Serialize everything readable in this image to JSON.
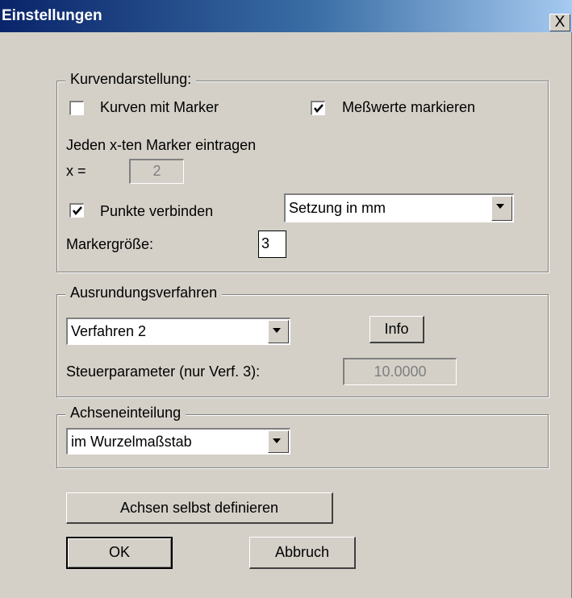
{
  "window": {
    "title": "Einstellungen",
    "close_glyph": "X"
  },
  "kurven": {
    "legend": "Kurvendarstellung:",
    "marker_cb": {
      "label": "Kurven mit Marker",
      "checked": false
    },
    "messwerte_cb": {
      "label": "Meßwerte markieren",
      "checked": true
    },
    "every_nth_label": "Jeden x-ten Marker eintragen",
    "x_label": "x =",
    "x_value": "2",
    "punkte_cb": {
      "label": "Punkte verbinden",
      "checked": true
    },
    "setzung_select": "Setzung in mm",
    "markersize_label": "Markergröße:",
    "markersize_value": "3"
  },
  "ausrundung": {
    "legend": "Ausrundungsverfahren",
    "verfahren_select": "Verfahren 2",
    "info_button": "Info",
    "steuer_label": "Steuerparameter (nur Verf. 3):",
    "steuer_value": "10.0000"
  },
  "achsen": {
    "legend": "Achseneinteilung",
    "scale_select": "im Wurzelmaßstab"
  },
  "buttons": {
    "define_axes": "Achsen selbst definieren",
    "ok": "OK",
    "cancel": "Abbruch"
  }
}
